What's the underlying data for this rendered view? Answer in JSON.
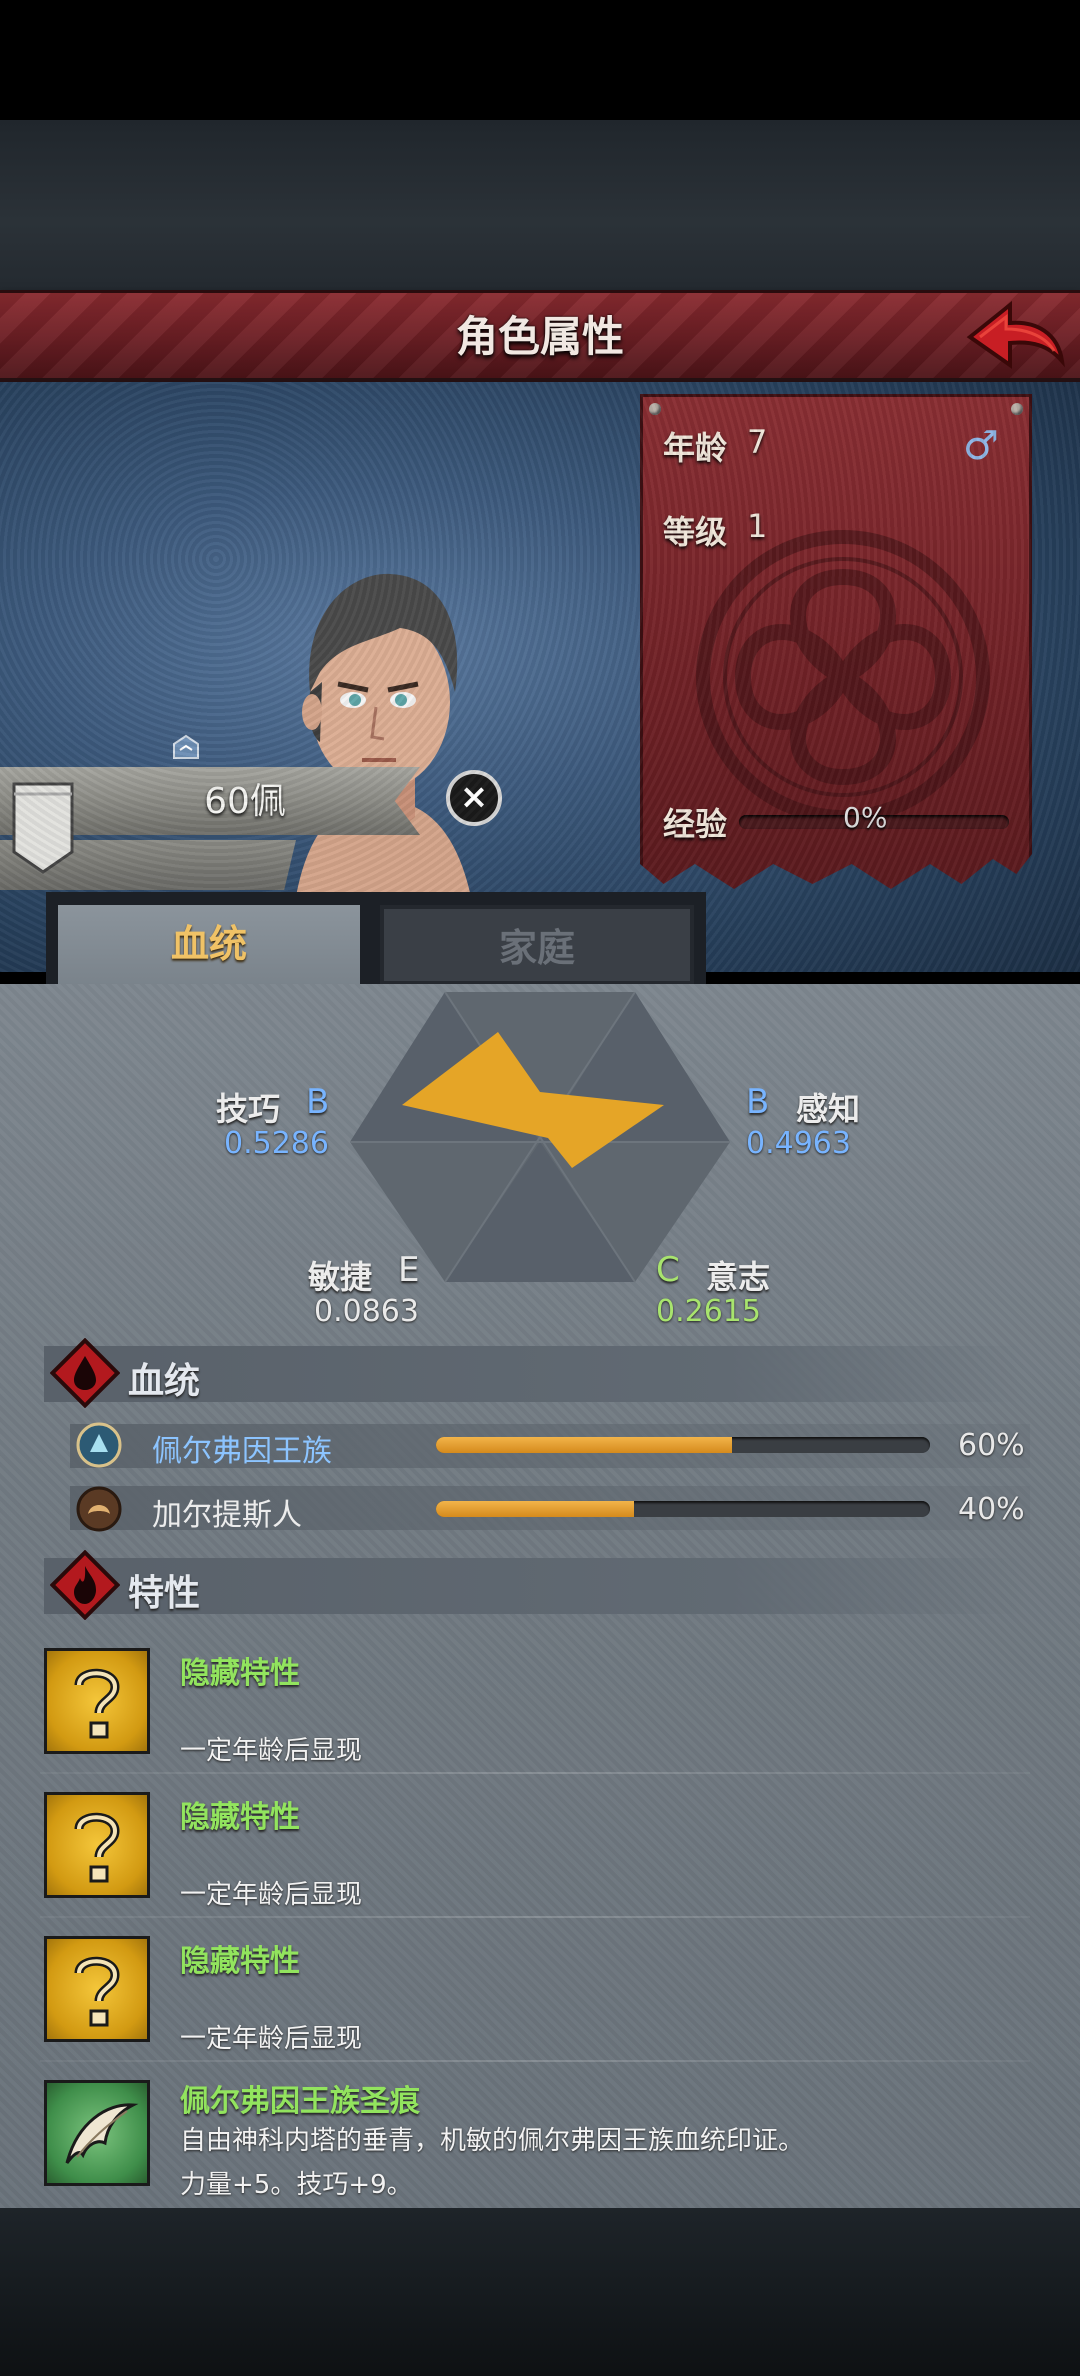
{
  "header": {
    "title": "角色属性"
  },
  "character": {
    "age_label": "年龄",
    "age_value": "7",
    "level_label": "等级",
    "level_value": "1",
    "exp_label": "经验",
    "exp_value": "0%",
    "exp_progress": 0,
    "name": "60佩"
  },
  "tabs": [
    {
      "label": "血统",
      "active": true
    },
    {
      "label": "家庭",
      "active": false
    }
  ],
  "attributes": {
    "skill": {
      "label": "技巧",
      "grade": "B",
      "value": "0.5286"
    },
    "perception": {
      "label": "感知",
      "grade": "B",
      "value": "0.4963"
    },
    "agility": {
      "label": "敏捷",
      "grade": "E",
      "value": "0.0863"
    },
    "will": {
      "label": "意志",
      "grade": "C",
      "value": "0.2615"
    }
  },
  "bloodline_section": {
    "title": "血统",
    "items": [
      {
        "name": "佩尔弗因王族",
        "percent": "60%",
        "fraction": 0.6,
        "name_color": "#8cc4ff"
      },
      {
        "name": "加尔提斯人",
        "percent": "40%",
        "fraction": 0.4,
        "name_color": "#ececec"
      }
    ]
  },
  "traits_section": {
    "title": "特性",
    "items": [
      {
        "name": "隐藏特性",
        "desc": "一定年龄后显现",
        "desc2": ""
      },
      {
        "name": "隐藏特性",
        "desc": "一定年龄后显现",
        "desc2": ""
      },
      {
        "name": "隐藏特性",
        "desc": "一定年龄后显现",
        "desc2": ""
      },
      {
        "name": "佩尔弗因王族圣痕",
        "desc": "自由神科内塔的垂青，机敏的佩尔弗因王族血统印证。",
        "desc2": "力量+5。技巧+9。"
      }
    ]
  },
  "colors": {
    "accent_gold": "#f0c266",
    "radar_fill": "#e5a527",
    "trait_green": "#92e45e"
  }
}
